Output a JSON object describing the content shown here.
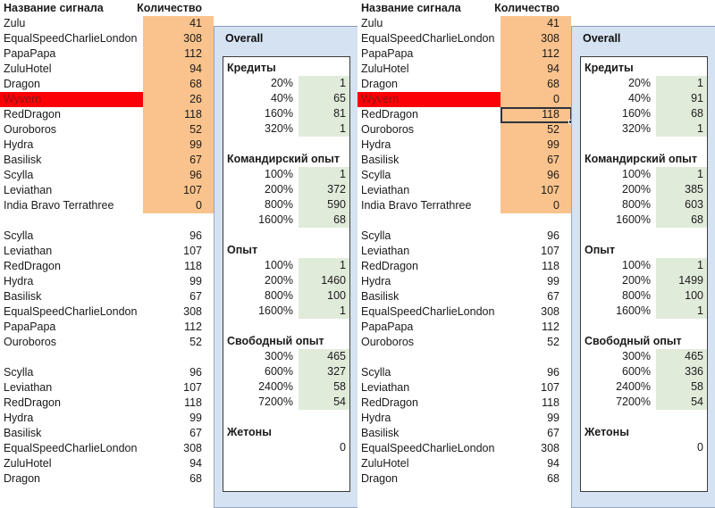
{
  "columns": {
    "name_header": "Название сигнала",
    "qty_header": "Количество"
  },
  "colors": {
    "qty_block": "#fac38d",
    "alert_row": "#fb0007",
    "overlay_bg": "#d5e2f2",
    "green_col": "#e1ebda",
    "selection": "#30323a"
  },
  "panels": [
    {
      "id": "left",
      "groups": [
        {
          "rows": [
            {
              "name": "Zulu",
              "qty": "41"
            },
            {
              "name": "EqualSpeedCharlieLondon",
              "qty": "308"
            },
            {
              "name": "PapaPapa",
              "qty": "112"
            },
            {
              "name": "ZuluHotel",
              "qty": "94"
            },
            {
              "name": "Dragon",
              "qty": "68"
            },
            {
              "name": "Wyvern",
              "qty": "26",
              "alert": true
            },
            {
              "name": "RedDragon",
              "qty": "118"
            },
            {
              "name": "Ouroboros",
              "qty": "52"
            },
            {
              "name": "Hydra",
              "qty": "99"
            },
            {
              "name": "Basilisk",
              "qty": "67"
            },
            {
              "name": "Scylla",
              "qty": "96"
            },
            {
              "name": "Leviathan",
              "qty": "107"
            },
            {
              "name": "India Bravo Terrathree",
              "qty": "0"
            }
          ]
        },
        {
          "rows": [
            {
              "name": "Scylla",
              "qty": "96"
            },
            {
              "name": "Leviathan",
              "qty": "107"
            },
            {
              "name": "RedDragon",
              "qty": "118"
            },
            {
              "name": "Hydra",
              "qty": "99"
            },
            {
              "name": "Basilisk",
              "qty": "67"
            },
            {
              "name": "EqualSpeedCharlieLondon",
              "qty": "308"
            },
            {
              "name": "PapaPapa",
              "qty": "112"
            },
            {
              "name": "Ouroboros",
              "qty": "52"
            }
          ]
        },
        {
          "rows": [
            {
              "name": "Scylla",
              "qty": "96"
            },
            {
              "name": "Leviathan",
              "qty": "107"
            },
            {
              "name": "RedDragon",
              "qty": "118"
            },
            {
              "name": "Hydra",
              "qty": "99"
            },
            {
              "name": "Basilisk",
              "qty": "67"
            },
            {
              "name": "EqualSpeedCharlieLondon",
              "qty": "308"
            },
            {
              "name": "ZuluHotel",
              "qty": "94"
            },
            {
              "name": "Dragon",
              "qty": "68"
            }
          ]
        }
      ],
      "selection": null,
      "overlay": {
        "title": "Overall",
        "sections": [
          {
            "title": "Кредиты",
            "rows": [
              {
                "pct": "20%",
                "val": "1"
              },
              {
                "pct": "40%",
                "val": "65"
              },
              {
                "pct": "160%",
                "val": "81"
              },
              {
                "pct": "320%",
                "val": "1"
              }
            ]
          },
          {
            "title": "Командирский опыт",
            "rows": [
              {
                "pct": "100%",
                "val": "1"
              },
              {
                "pct": "200%",
                "val": "372"
              },
              {
                "pct": "800%",
                "val": "590"
              },
              {
                "pct": "1600%",
                "val": "68"
              }
            ]
          },
          {
            "title": "Опыт",
            "rows": [
              {
                "pct": "100%",
                "val": "1"
              },
              {
                "pct": "200%",
                "val": "1460"
              },
              {
                "pct": "800%",
                "val": "100"
              },
              {
                "pct": "1600%",
                "val": "1"
              }
            ]
          },
          {
            "title": "Свободный опыт",
            "rows": [
              {
                "pct": "300%",
                "val": "465"
              },
              {
                "pct": "600%",
                "val": "327"
              },
              {
                "pct": "2400%",
                "val": "58"
              },
              {
                "pct": "7200%",
                "val": "54"
              }
            ]
          },
          {
            "title": "Жетоны",
            "rows": [
              {
                "pct": "",
                "val": "0",
                "noval": true
              }
            ]
          }
        ]
      }
    },
    {
      "id": "right",
      "groups": [
        {
          "rows": [
            {
              "name": "Zulu",
              "qty": "41"
            },
            {
              "name": "EqualSpeedCharlieLondon",
              "qty": "308"
            },
            {
              "name": "PapaPapa",
              "qty": "112"
            },
            {
              "name": "ZuluHotel",
              "qty": "94"
            },
            {
              "name": "Dragon",
              "qty": "68"
            },
            {
              "name": "Wyvern",
              "qty": "0",
              "alert": true
            },
            {
              "name": "RedDragon",
              "qty": "118",
              "selected": true
            },
            {
              "name": "Ouroboros",
              "qty": "52"
            },
            {
              "name": "Hydra",
              "qty": "99"
            },
            {
              "name": "Basilisk",
              "qty": "67"
            },
            {
              "name": "Scylla",
              "qty": "96"
            },
            {
              "name": "Leviathan",
              "qty": "107"
            },
            {
              "name": "India Bravo Terrathree",
              "qty": "0"
            }
          ]
        },
        {
          "rows": [
            {
              "name": "Scylla",
              "qty": "96"
            },
            {
              "name": "Leviathan",
              "qty": "107"
            },
            {
              "name": "RedDragon",
              "qty": "118"
            },
            {
              "name": "Hydra",
              "qty": "99"
            },
            {
              "name": "Basilisk",
              "qty": "67"
            },
            {
              "name": "EqualSpeedCharlieLondon",
              "qty": "308"
            },
            {
              "name": "PapaPapa",
              "qty": "112"
            },
            {
              "name": "Ouroboros",
              "qty": "52"
            }
          ]
        },
        {
          "rows": [
            {
              "name": "Scylla",
              "qty": "96"
            },
            {
              "name": "Leviathan",
              "qty": "107"
            },
            {
              "name": "RedDragon",
              "qty": "118"
            },
            {
              "name": "Hydra",
              "qty": "99"
            },
            {
              "name": "Basilisk",
              "qty": "67"
            },
            {
              "name": "EqualSpeedCharlieLondon",
              "qty": "308"
            },
            {
              "name": "ZuluHotel",
              "qty": "94"
            },
            {
              "name": "Dragon",
              "qty": "68"
            }
          ]
        }
      ],
      "overlay": {
        "title": "Overall",
        "sections": [
          {
            "title": "Кредиты",
            "rows": [
              {
                "pct": "20%",
                "val": "1"
              },
              {
                "pct": "40%",
                "val": "91"
              },
              {
                "pct": "160%",
                "val": "68"
              },
              {
                "pct": "320%",
                "val": "1"
              }
            ]
          },
          {
            "title": "Командирский опыт",
            "rows": [
              {
                "pct": "100%",
                "val": "1"
              },
              {
                "pct": "200%",
                "val": "385"
              },
              {
                "pct": "800%",
                "val": "603"
              },
              {
                "pct": "1600%",
                "val": "68"
              }
            ]
          },
          {
            "title": "Опыт",
            "rows": [
              {
                "pct": "100%",
                "val": "1"
              },
              {
                "pct": "200%",
                "val": "1499"
              },
              {
                "pct": "800%",
                "val": "100"
              },
              {
                "pct": "1600%",
                "val": "1"
              }
            ]
          },
          {
            "title": "Свободный опыт",
            "rows": [
              {
                "pct": "300%",
                "val": "465"
              },
              {
                "pct": "600%",
                "val": "336"
              },
              {
                "pct": "2400%",
                "val": "58"
              },
              {
                "pct": "7200%",
                "val": "54"
              }
            ]
          },
          {
            "title": "Жетоны",
            "rows": [
              {
                "pct": "",
                "val": "0",
                "noval": true
              }
            ]
          }
        ]
      }
    }
  ]
}
